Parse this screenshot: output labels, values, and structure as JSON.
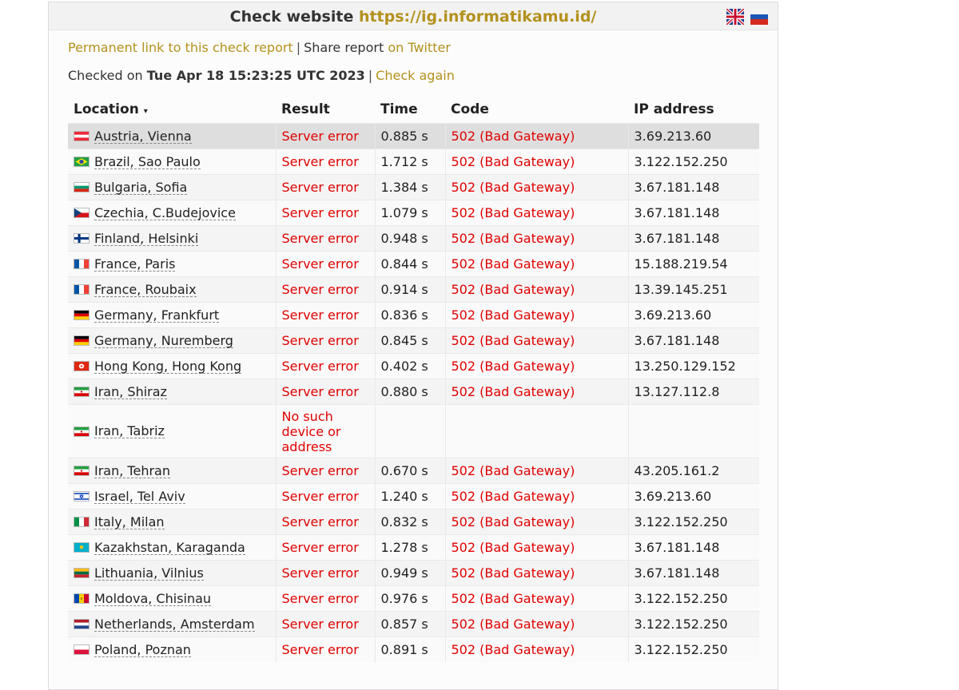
{
  "header": {
    "prefix": "Check website",
    "url": "https://ig.informatikamu.id/"
  },
  "links": {
    "permanent": "Permanent link to this check report",
    "sep": "|",
    "share": "Share report",
    "twitter": "on Twitter"
  },
  "checked": {
    "label": "Checked on",
    "datetime": "Tue Apr 18 15:23:25 UTC 2023",
    "sep": "|",
    "again": "Check again"
  },
  "table": {
    "headers": {
      "location": "Location",
      "sort": "▾",
      "result": "Result",
      "time": "Time",
      "code": "Code",
      "ip": "IP address"
    },
    "rows": [
      {
        "flag": "at",
        "location": "Austria, Vienna",
        "result": "Server error",
        "time": "0.885 s",
        "code": "502 (Bad Gateway)",
        "ip": "3.69.213.60"
      },
      {
        "flag": "br",
        "location": "Brazil, Sao Paulo",
        "result": "Server error",
        "time": "1.712 s",
        "code": "502 (Bad Gateway)",
        "ip": "3.122.152.250"
      },
      {
        "flag": "bg",
        "location": "Bulgaria, Sofia",
        "result": "Server error",
        "time": "1.384 s",
        "code": "502 (Bad Gateway)",
        "ip": "3.67.181.148"
      },
      {
        "flag": "cz",
        "location": "Czechia, C.Budejovice",
        "result": "Server error",
        "time": "1.079 s",
        "code": "502 (Bad Gateway)",
        "ip": "3.67.181.148"
      },
      {
        "flag": "fi",
        "location": "Finland, Helsinki",
        "result": "Server error",
        "time": "0.948 s",
        "code": "502 (Bad Gateway)",
        "ip": "3.67.181.148"
      },
      {
        "flag": "fr",
        "location": "France, Paris",
        "result": "Server error",
        "time": "0.844 s",
        "code": "502 (Bad Gateway)",
        "ip": "15.188.219.54"
      },
      {
        "flag": "fr",
        "location": "France, Roubaix",
        "result": "Server error",
        "time": "0.914 s",
        "code": "502 (Bad Gateway)",
        "ip": "13.39.145.251"
      },
      {
        "flag": "de",
        "location": "Germany, Frankfurt",
        "result": "Server error",
        "time": "0.836 s",
        "code": "502 (Bad Gateway)",
        "ip": "3.69.213.60"
      },
      {
        "flag": "de",
        "location": "Germany, Nuremberg",
        "result": "Server error",
        "time": "0.845 s",
        "code": "502 (Bad Gateway)",
        "ip": "3.67.181.148"
      },
      {
        "flag": "hk",
        "location": "Hong Kong, Hong Kong",
        "result": "Server error",
        "time": "0.402 s",
        "code": "502 (Bad Gateway)",
        "ip": "13.250.129.152"
      },
      {
        "flag": "ir",
        "location": "Iran, Shiraz",
        "result": "Server error",
        "time": "0.880 s",
        "code": "502 (Bad Gateway)",
        "ip": "13.127.112.8"
      },
      {
        "flag": "ir",
        "location": "Iran, Tabriz",
        "result": "No such device or address",
        "time": "",
        "code": "",
        "ip": "",
        "tall": true
      },
      {
        "flag": "ir",
        "location": "Iran, Tehran",
        "result": "Server error",
        "time": "0.670 s",
        "code": "502 (Bad Gateway)",
        "ip": "43.205.161.2"
      },
      {
        "flag": "il",
        "location": "Israel, Tel Aviv",
        "result": "Server error",
        "time": "1.240 s",
        "code": "502 (Bad Gateway)",
        "ip": "3.69.213.60"
      },
      {
        "flag": "it",
        "location": "Italy, Milan",
        "result": "Server error",
        "time": "0.832 s",
        "code": "502 (Bad Gateway)",
        "ip": "3.122.152.250"
      },
      {
        "flag": "kz",
        "location": "Kazakhstan, Karaganda",
        "result": "Server error",
        "time": "1.278 s",
        "code": "502 (Bad Gateway)",
        "ip": "3.67.181.148"
      },
      {
        "flag": "lt",
        "location": "Lithuania, Vilnius",
        "result": "Server error",
        "time": "0.949 s",
        "code": "502 (Bad Gateway)",
        "ip": "3.67.181.148"
      },
      {
        "flag": "md",
        "location": "Moldova, Chisinau",
        "result": "Server error",
        "time": "0.976 s",
        "code": "502 (Bad Gateway)",
        "ip": "3.122.152.250"
      },
      {
        "flag": "nl",
        "location": "Netherlands, Amsterdam",
        "result": "Server error",
        "time": "0.857 s",
        "code": "502 (Bad Gateway)",
        "ip": "3.122.152.250"
      },
      {
        "flag": "pl",
        "location": "Poland, Poznan",
        "result": "Server error",
        "time": "0.891 s",
        "code": "502 (Bad Gateway)",
        "ip": "3.122.152.250"
      }
    ]
  },
  "colors": {
    "link": "#b3911d",
    "error": "#e00000"
  }
}
